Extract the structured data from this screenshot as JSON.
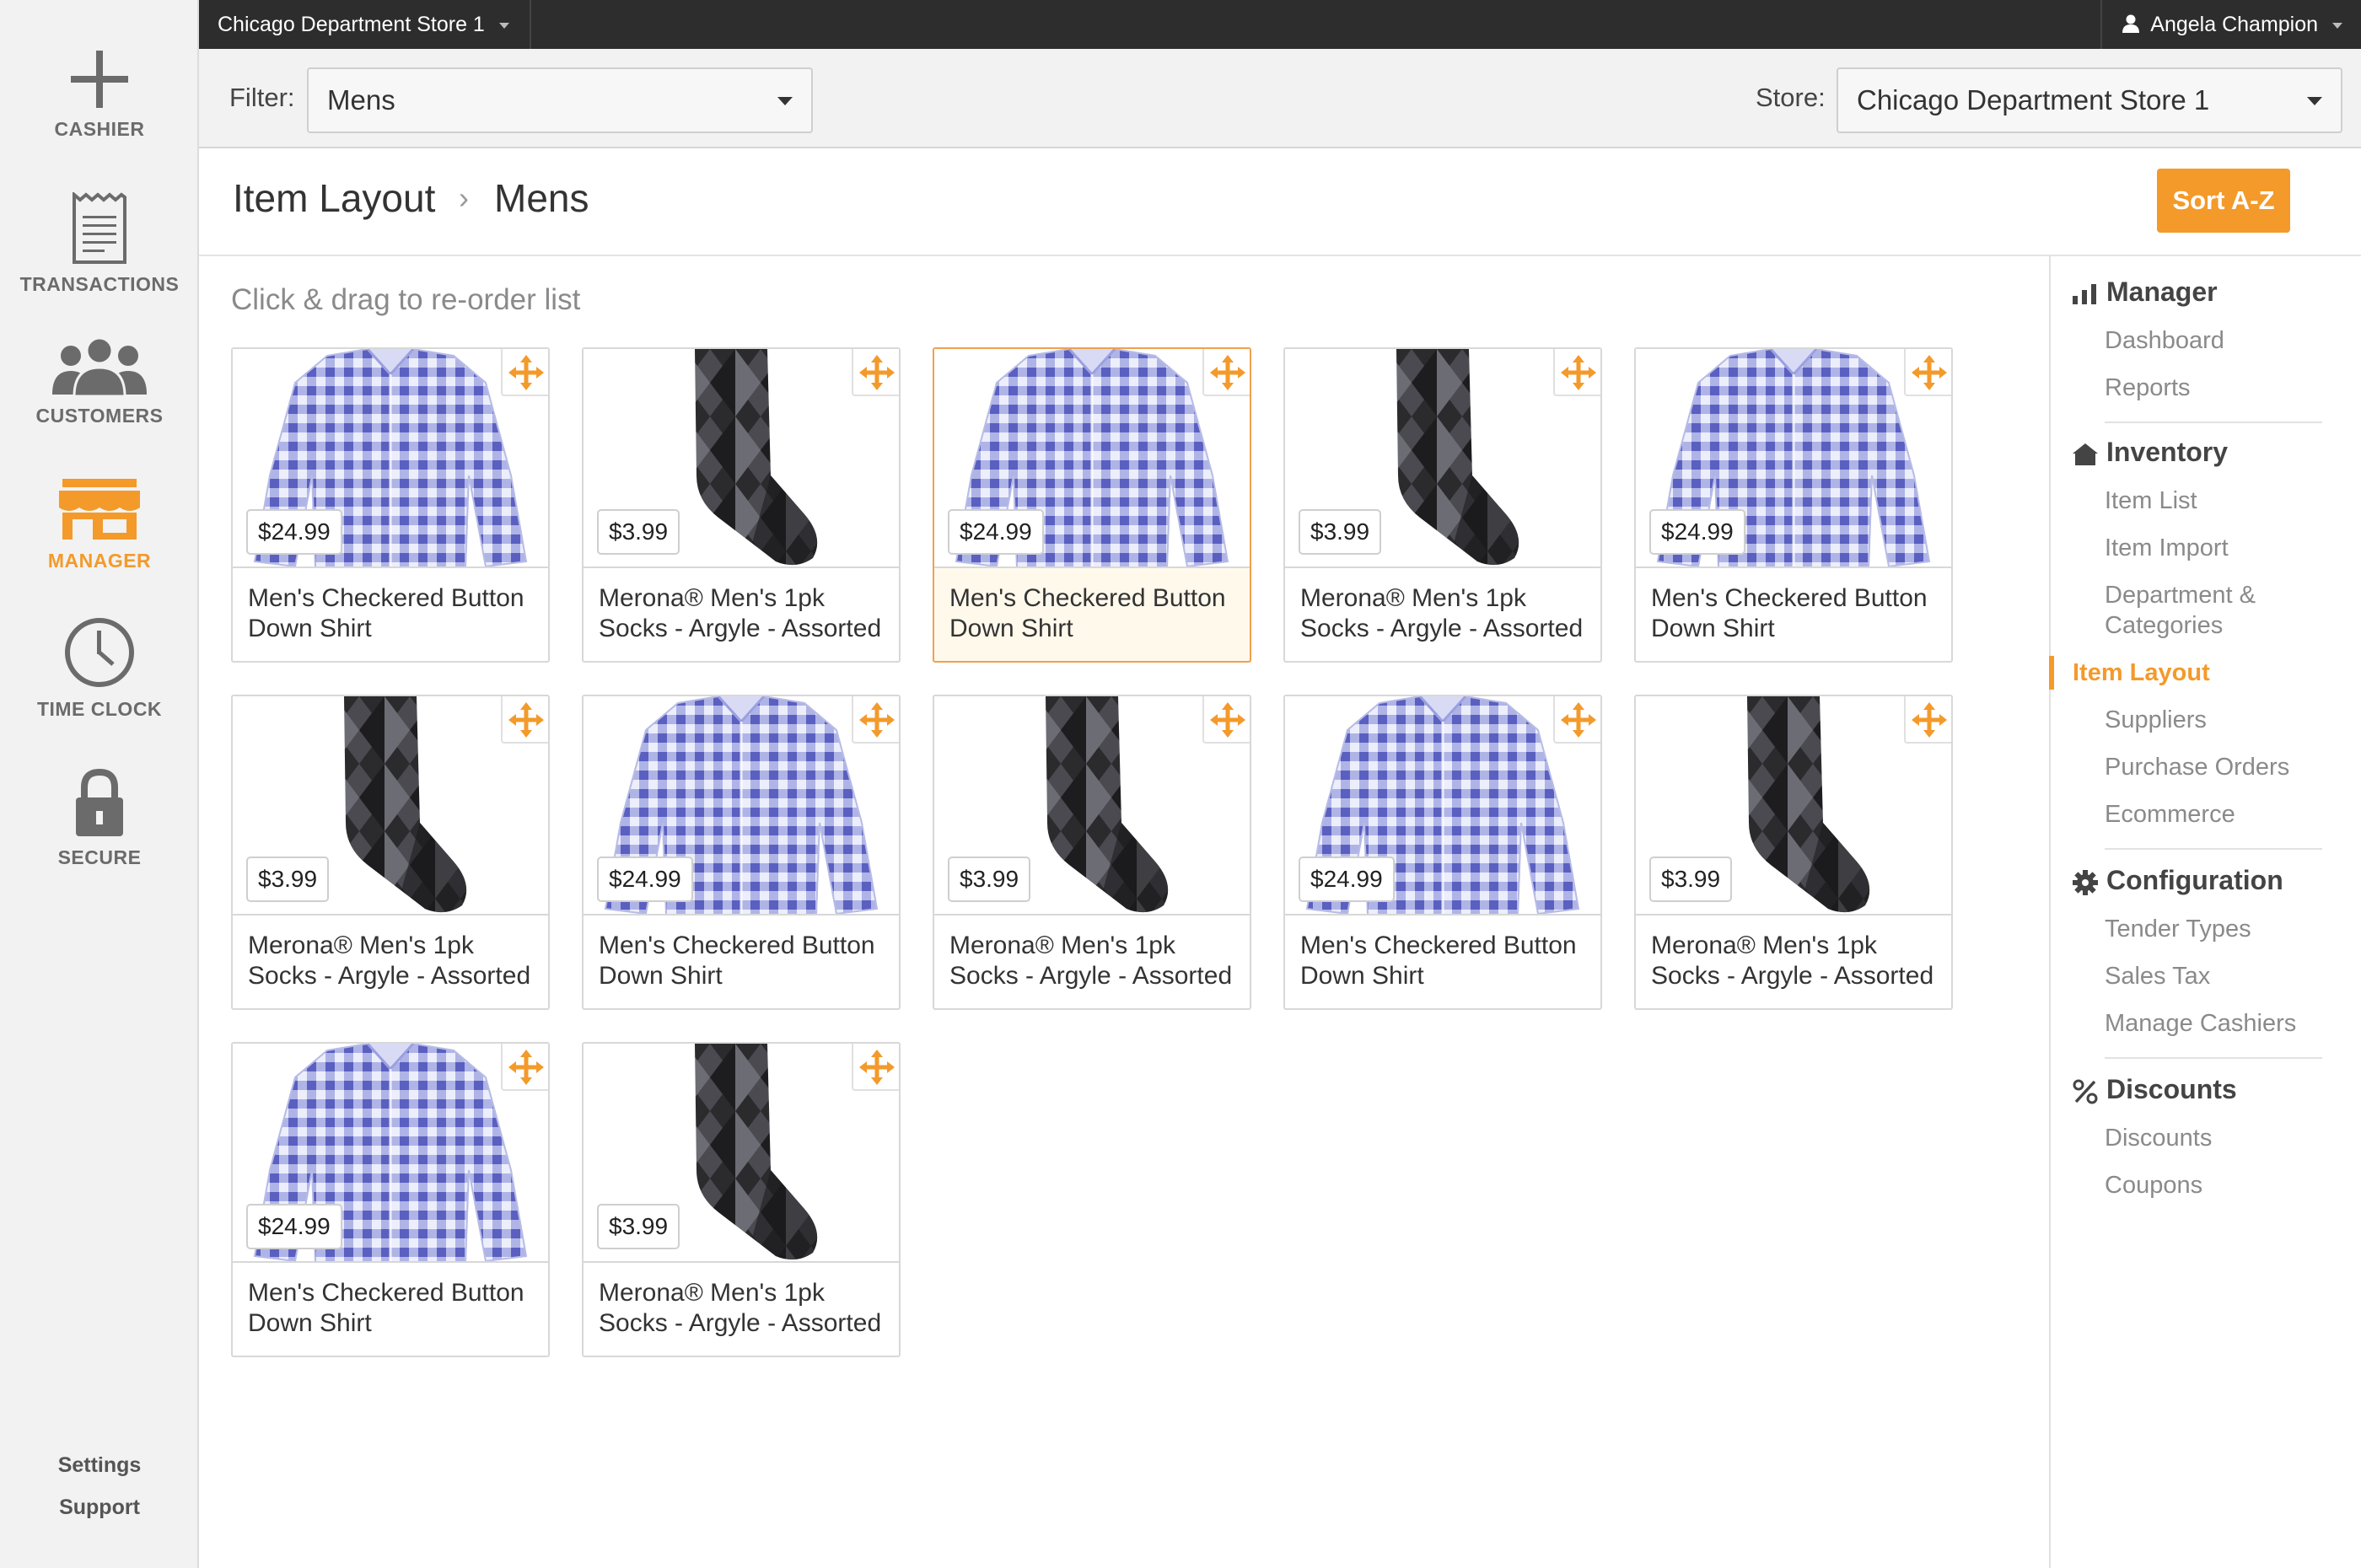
{
  "nav": {
    "cashier": "CASHIER",
    "transactions": "TRANSACTIONS",
    "customers": "CUSTOMERS",
    "manager": "MANAGER",
    "timeclock": "TIME CLOCK",
    "secure": "SECURE",
    "settings": "Settings",
    "support": "Support"
  },
  "topbar": {
    "store": "Chicago Department Store 1",
    "user": "Angela Champion"
  },
  "filters": {
    "filter_label": "Filter:",
    "filter_value": "Mens",
    "store_label": "Store:",
    "store_value": "Chicago Department Store 1"
  },
  "header": {
    "crumb1": "Item Layout",
    "crumb_sep": "›",
    "crumb2": "Mens",
    "sort_label": "Sort A-Z"
  },
  "main": {
    "instructions": "Click & drag to re-order list"
  },
  "items": [
    {
      "name": "Men's Checkered Button Down Shirt",
      "price": "$24.99",
      "type": "shirt"
    },
    {
      "name": "Merona® Men's 1pk Socks - Argyle - Assorted",
      "price": "$3.99",
      "type": "sock"
    },
    {
      "name": "Men's Checkered Button Down Shirt",
      "price": "$24.99",
      "type": "shirt"
    },
    {
      "name": "Merona® Men's 1pk Socks - Argyle - Assorted",
      "price": "$3.99",
      "type": "sock"
    },
    {
      "name": "Men's Checkered Button Down Shirt",
      "price": "$24.99",
      "type": "shirt"
    },
    {
      "name": "Merona® Men's 1pk Socks - Argyle - Assorted",
      "price": "$3.99",
      "type": "sock"
    },
    {
      "name": "Men's Checkered Button Down Shirt",
      "price": "$24.99",
      "type": "shirt"
    },
    {
      "name": "Merona® Men's 1pk Socks - Argyle - Assorted",
      "price": "$3.99",
      "type": "sock"
    },
    {
      "name": "Men's Checkered Button Down Shirt",
      "price": "$24.99",
      "type": "shirt"
    },
    {
      "name": "Merona® Men's 1pk Socks - Argyle - Assorted",
      "price": "$3.99",
      "type": "sock"
    },
    {
      "name": "Men's Checkered Button Down Shirt",
      "price": "$24.99",
      "type": "shirt"
    },
    {
      "name": "Merona® Men's 1pk Socks - Argyle - Assorted",
      "price": "$3.99",
      "type": "sock"
    }
  ],
  "selected_item_index": 2,
  "sidebar": {
    "manager": {
      "title": "Manager",
      "items": [
        "Dashboard",
        "Reports"
      ]
    },
    "inventory": {
      "title": "Inventory",
      "items": [
        "Item List",
        "Item Import",
        "Department & Categories",
        "Item Layout",
        "Suppliers",
        "Purchase Orders",
        "Ecommerce"
      ]
    },
    "configuration": {
      "title": "Configuration",
      "items": [
        "Tender Types",
        "Sales Tax",
        "Manage Cashiers"
      ]
    },
    "discounts": {
      "title": "Discounts",
      "items": [
        "Discounts",
        "Coupons"
      ]
    },
    "active": "Item Layout"
  },
  "colors": {
    "accent": "#f39a2b",
    "topbar": "#2d2d2d",
    "nav_bg": "#f2f2f2",
    "shirt_check": "#6f72c9",
    "sock_dark": "#2b2b2e"
  }
}
